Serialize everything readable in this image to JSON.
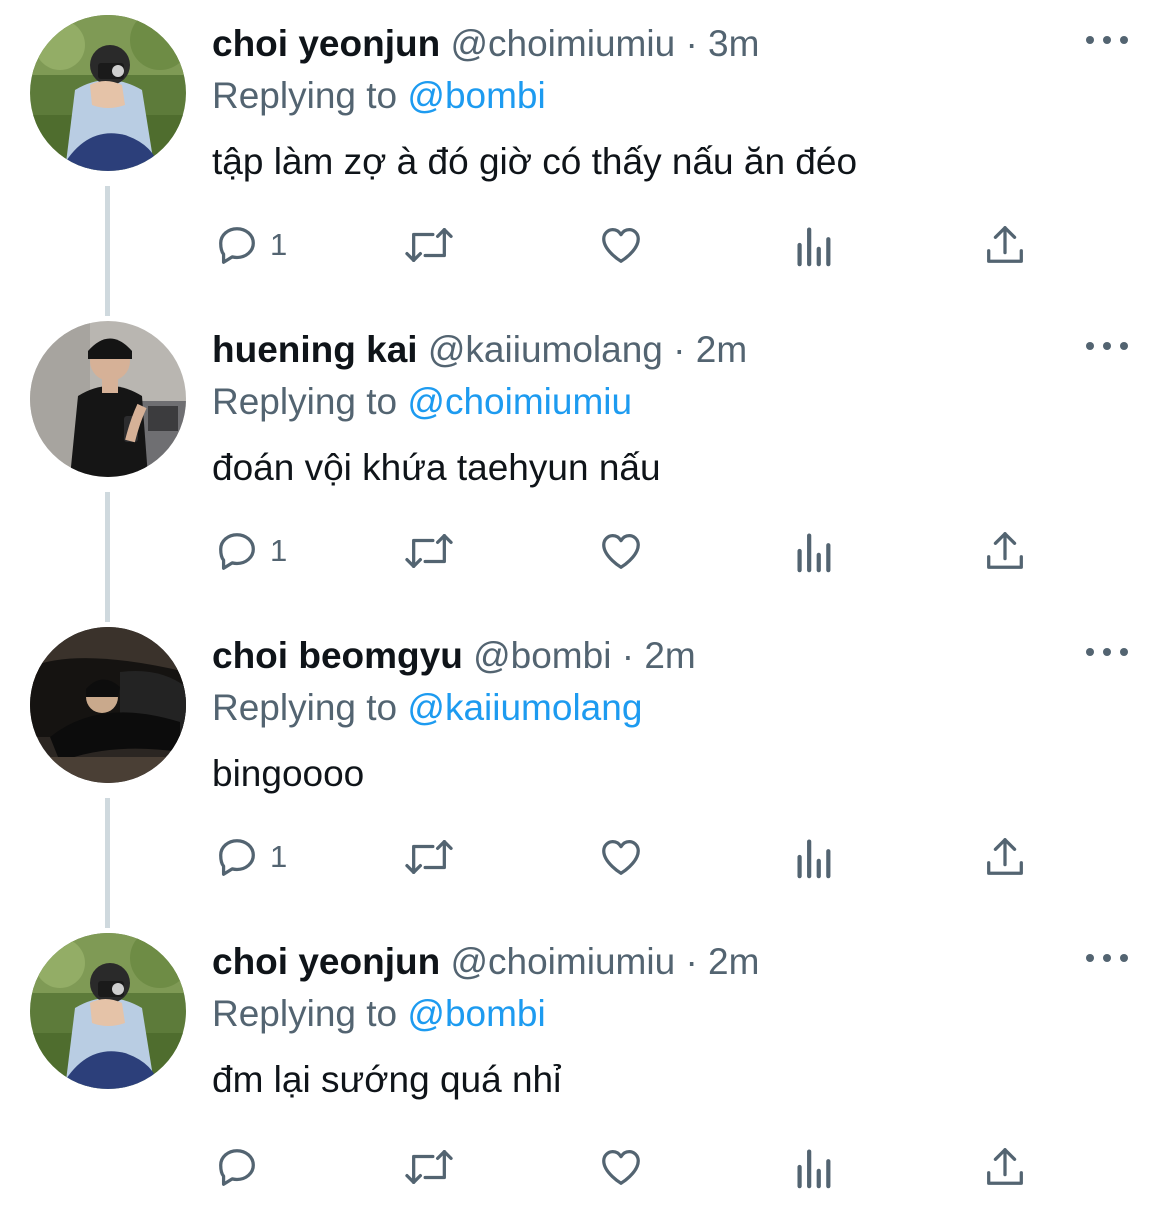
{
  "tweets": [
    {
      "name": "choi yeonjun",
      "handle": "@choimiumiu",
      "separator": "·",
      "time": "3m",
      "replying_prefix": "Replying to",
      "replying_to": "@bombi",
      "text": "tập làm zợ à đó giờ có thấy nấu ăn đéo",
      "reply_count": "1",
      "avatar": "profile-photo-camera-grass"
    },
    {
      "name": "huening kai",
      "handle": "@kaiiumolang",
      "separator": "·",
      "time": "2m",
      "replying_prefix": "Replying to",
      "replying_to": "@choimiumiu",
      "text": "đoán vội khứa taehyun nấu",
      "reply_count": "1",
      "avatar": "profile-photo-mirror-selfie"
    },
    {
      "name": "choi beomgyu",
      "handle": "@bombi",
      "separator": "·",
      "time": "2m",
      "replying_prefix": "Replying to",
      "replying_to": "@kaiiumolang",
      "text": "bingoooo",
      "reply_count": "1",
      "avatar": "profile-photo-couch-dark"
    },
    {
      "name": "choi yeonjun",
      "handle": "@choimiumiu",
      "separator": "·",
      "time": "2m",
      "replying_prefix": "Replying to",
      "replying_to": "@bombi",
      "text": "đm lại sướng quá nhỉ",
      "reply_count": "",
      "avatar": "profile-photo-camera-grass"
    }
  ],
  "icons": {
    "reply": "reply-bubble-icon",
    "retweet": "retweet-arrows-icon",
    "like": "heart-icon",
    "views": "bar-chart-icon",
    "share": "share-upload-icon",
    "more": "more-dots-icon"
  },
  "colors": {
    "text": "#0f1419",
    "secondary": "#536471",
    "link": "#1d9bf0",
    "thread_line": "#cfd9de"
  }
}
